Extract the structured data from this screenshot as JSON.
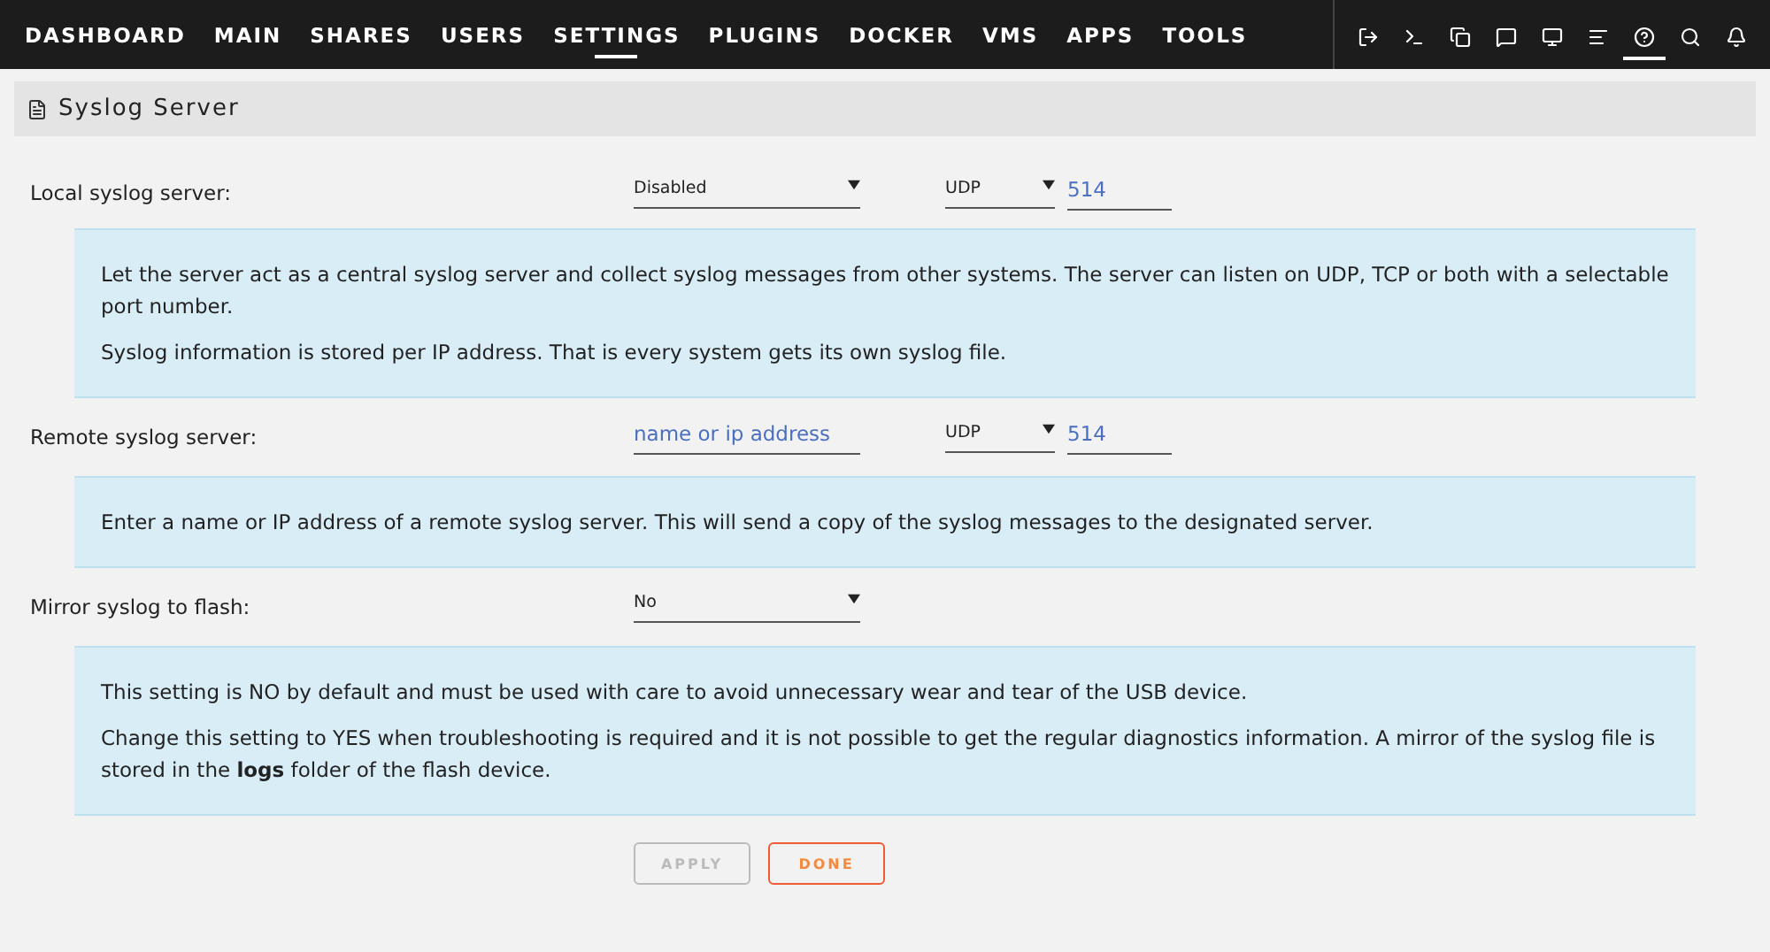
{
  "nav": [
    {
      "label": "DASHBOARD",
      "selected": false
    },
    {
      "label": "MAIN",
      "selected": false
    },
    {
      "label": "SHARES",
      "selected": false
    },
    {
      "label": "USERS",
      "selected": false
    },
    {
      "label": "SETTINGS",
      "selected": true
    },
    {
      "label": "PLUGINS",
      "selected": false
    },
    {
      "label": "DOCKER",
      "selected": false
    },
    {
      "label": "VMS",
      "selected": false
    },
    {
      "label": "APPS",
      "selected": false
    },
    {
      "label": "TOOLS",
      "selected": false
    }
  ],
  "toolbar": [
    {
      "kind": "logout",
      "selected": false
    },
    {
      "kind": "terminal",
      "selected": false
    },
    {
      "kind": "copy",
      "selected": false
    },
    {
      "kind": "message",
      "selected": false
    },
    {
      "kind": "monitor",
      "selected": false
    },
    {
      "kind": "log",
      "selected": false
    },
    {
      "kind": "help",
      "selected": true
    },
    {
      "kind": "search",
      "selected": false
    },
    {
      "kind": "bell",
      "selected": false
    }
  ],
  "panel": {
    "title": "Syslog Server"
  },
  "settings": [
    {
      "label": "Local syslog server:",
      "controls": [
        {
          "kind": "mode-select",
          "value": "Disabled"
        },
        {
          "kind": "protocol-select",
          "value": "UDP"
        },
        {
          "kind": "port-input",
          "value": "514"
        }
      ],
      "info": [
        "Let the server act as a central syslog server and collect syslog messages from other systems. The server can listen on UDP, TCP or both with a selectable port number.",
        "Syslog information is stored per IP address. That is every system gets its own syslog file."
      ]
    },
    {
      "label": "Remote syslog server:",
      "controls": [
        {
          "kind": "host-input",
          "placeholder": "name or ip address"
        },
        {
          "kind": "protocol-select",
          "value": "UDP"
        },
        {
          "kind": "port-input",
          "value": "514"
        }
      ],
      "info": [
        "Enter a name or IP address of a remote syslog server. This will send a copy of the syslog messages to the designated server."
      ]
    },
    {
      "label": "Mirror syslog to flash:",
      "controls": [
        {
          "kind": "mode-select",
          "value": "No"
        }
      ],
      "info": [
        "This setting is NO by default and must be used with care to avoid unnecessary wear and tear of the USB device.",
        "Change this setting to YES when troubleshooting is required and it is not possible to get the regular diagnostics information. A mirror of the syslog file is stored in the **logs** folder of the flash device."
      ]
    }
  ],
  "buttons": [
    {
      "label": "APPLY",
      "disabled": true
    },
    {
      "label": "DONE",
      "disabled": false
    }
  ]
}
